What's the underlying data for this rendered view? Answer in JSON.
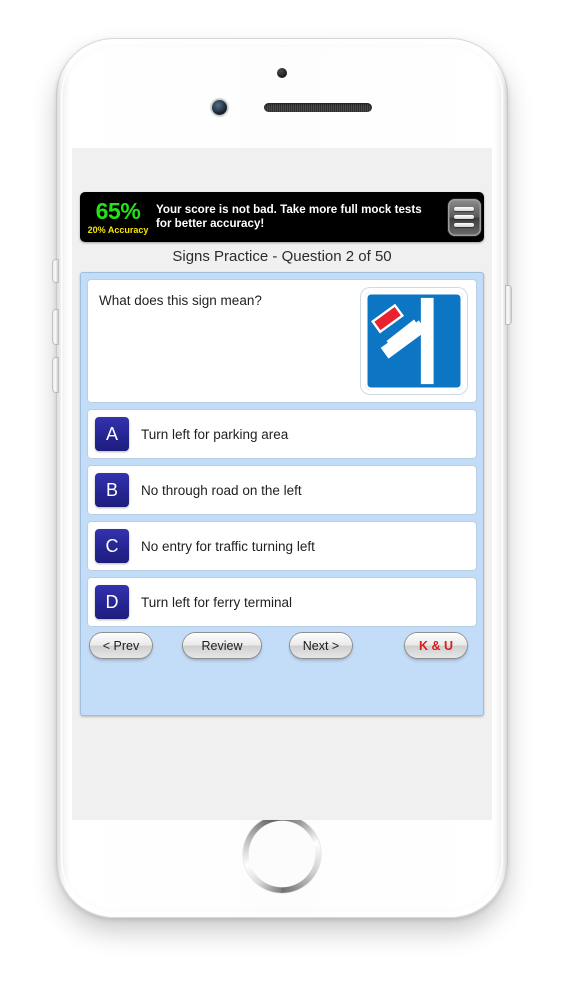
{
  "device": {
    "name": "smartphone-mockup",
    "hardware": {
      "proximity_sensor": "proximity-sensor",
      "front_camera": "front-camera",
      "earpiece": "earpiece-speaker",
      "home_button": "home-button",
      "silent_switch": "silent-switch",
      "volume_up": "volume-up",
      "volume_down": "volume-down",
      "power_button": "power-button"
    }
  },
  "score_banner": {
    "percent": "65%",
    "accuracy": "20% Accuracy",
    "message": "Your score is not bad. Take more full mock tests for better accuracy!",
    "menu_icon": "hamburger-menu-icon",
    "colors": {
      "background": "#000000",
      "percent_color": "#23e316",
      "accuracy_color": "#f5e600",
      "message_color": "#ffffff"
    }
  },
  "title": {
    "text": "Signs Practice - Question 2 of 50"
  },
  "question": {
    "prompt": "What does this sign mean?",
    "sign": {
      "name": "no-through-road-on-the-left-sign",
      "description": "Blue square road sign with a white main road and a white side road branching up-left ending in a red bar",
      "colors": {
        "background": "#0d76c4",
        "road": "#ffffff",
        "bar": "#e8222e",
        "border": "#ffffff"
      }
    }
  },
  "answers": [
    {
      "letter": "A",
      "text": "Turn left for parking area"
    },
    {
      "letter": "B",
      "text": "No through road on the left"
    },
    {
      "letter": "C",
      "text": "No entry for traffic turning left"
    },
    {
      "letter": "D",
      "text": "Turn left for ferry terminal"
    }
  ],
  "nav": {
    "prev": "< Prev",
    "review": "Review",
    "next": "Next >",
    "ku": "K & U",
    "ku_color": "#e01b1b"
  },
  "panel": {
    "background": "#c3dcf7"
  }
}
